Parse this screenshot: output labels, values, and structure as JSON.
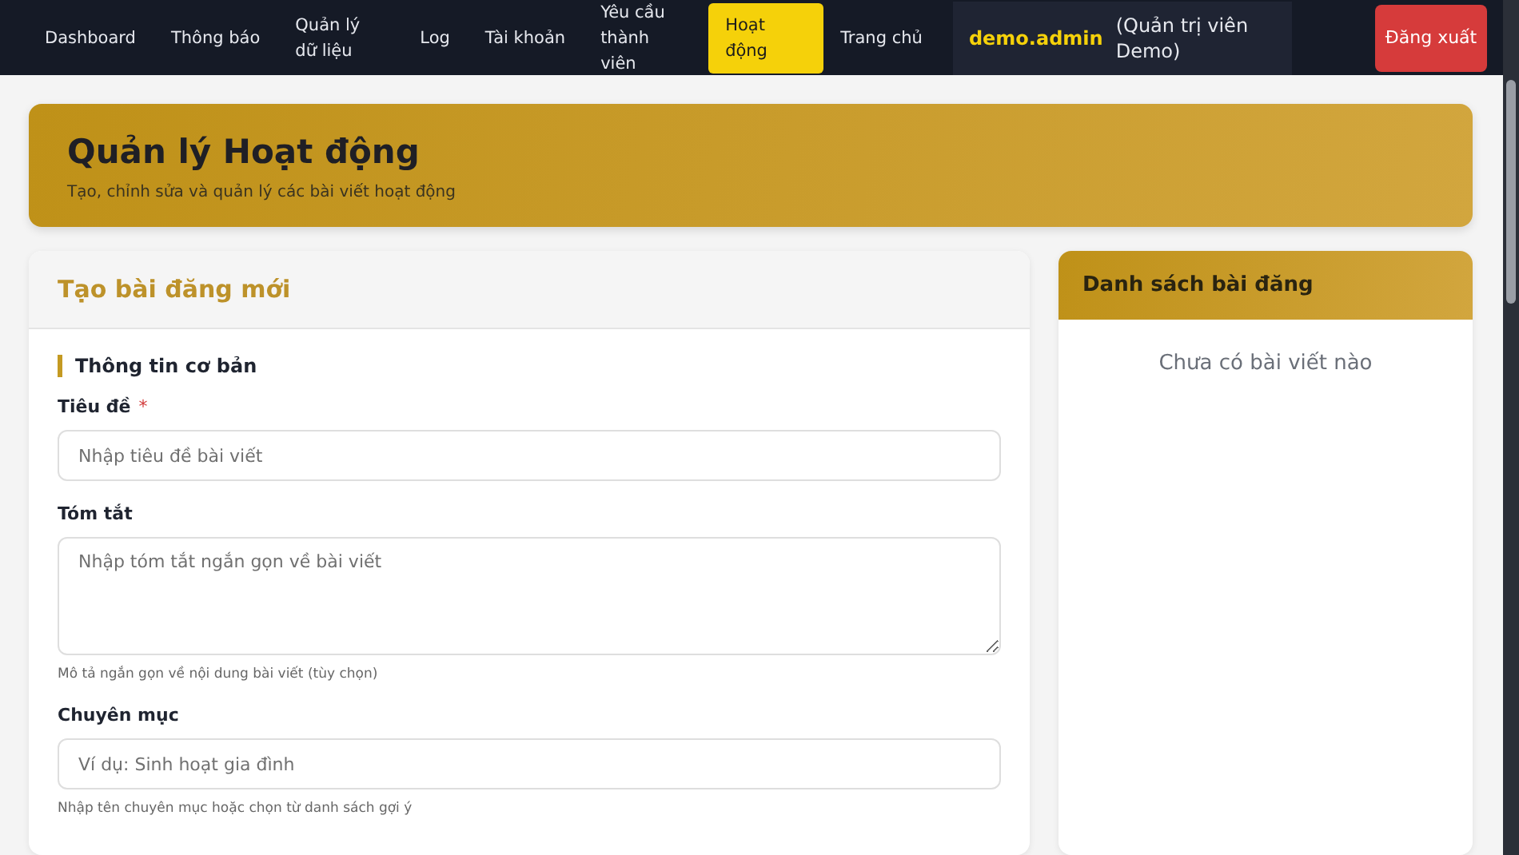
{
  "nav": {
    "items": [
      {
        "label": "Dashboard",
        "selected": false
      },
      {
        "label": "Thông báo",
        "selected": false
      },
      {
        "label": "Quản lý dữ liệu",
        "selected": false
      },
      {
        "label": "Log",
        "selected": false
      },
      {
        "label": "Tài khoản",
        "selected": false
      },
      {
        "label": "Yêu cầu thành viên",
        "selected": false
      },
      {
        "label": "Hoạt động",
        "selected": true
      },
      {
        "label": "Trang chủ",
        "selected": false
      }
    ],
    "user": {
      "name": "demo.admin",
      "role": "(Quản trị viên Demo)"
    },
    "logout": "Đăng xuất"
  },
  "header": {
    "title": "Quản lý Hoạt động",
    "subtitle": "Tạo, chỉnh sửa và quản lý các bài viết hoạt động"
  },
  "form": {
    "title": "Tạo bài đăng mới",
    "section": "Thông tin cơ bản",
    "fields": [
      {
        "kind": "input",
        "label": "Tiêu đề",
        "required_mark": "*",
        "placeholder": "Nhập tiêu đề bài viết"
      },
      {
        "kind": "textarea",
        "label": "Tóm tắt",
        "placeholder": "Nhập tóm tắt ngắn gọn về bài viết",
        "hint": "Mô tả ngắn gọn về nội dung bài viết (tùy chọn)"
      },
      {
        "kind": "input",
        "label": "Chuyên mục",
        "placeholder": "Ví dụ: Sinh hoạt gia đình",
        "hint": "Nhập tên chuyên mục hoặc chọn từ danh sách gợi ý"
      }
    ]
  },
  "posts": {
    "title": "Danh sách bài đăng",
    "empty": "Chưa có bài viết nào"
  }
}
